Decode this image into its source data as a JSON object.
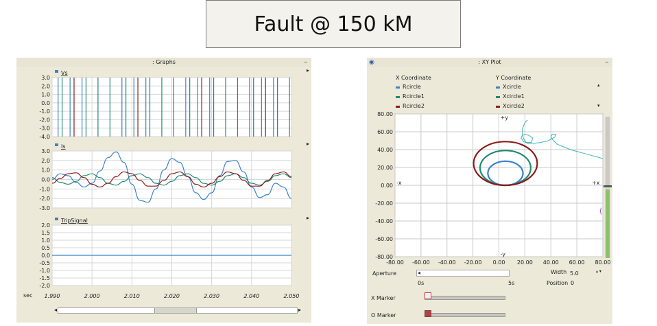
{
  "title": "Fault @ 150 kM",
  "graphs_panel": {
    "title": ": Graphs",
    "min_symbol": "–",
    "time_unit": "sec",
    "x_ticks": [
      "1.990",
      "2.000",
      "2.010",
      "2.020",
      "2.030",
      "2.040",
      "2.050"
    ],
    "x_range": [
      1.99,
      2.05
    ]
  },
  "xy_panel": {
    "title": ": XY Plot",
    "min_symbol": "–",
    "x_coord_header": "X Coordinate",
    "y_coord_header": "Y Coordinate",
    "x_legend": [
      {
        "name": "Rcircle",
        "color": "#3b82c9"
      },
      {
        "name": "Rcircle1",
        "color": "#1f8a70"
      },
      {
        "name": "Rcircle2",
        "color": "#8b1a1a"
      }
    ],
    "y_legend": [
      {
        "name": "Xcircle",
        "color": "#3b82c9"
      },
      {
        "name": "Xcircle1",
        "color": "#1f8a70"
      },
      {
        "name": "Xcircle2",
        "color": "#8b1a1a"
      }
    ],
    "axis_labels": {
      "plus_y": "+y",
      "minus_y": "-y",
      "plus_x": "+x",
      "minus_x": "-x"
    },
    "aperture_label": "Aperture",
    "width_label": "Width",
    "width_value": "5.0",
    "time_start": "0s",
    "time_end": "5s",
    "position_label": "Position",
    "position_value": "0",
    "x_marker_label": "X Marker",
    "o_marker_label": "O Marker"
  },
  "chart_data": [
    {
      "type": "line",
      "title": "Vs",
      "ylim": [
        -4.0,
        3.0
      ],
      "y_ticks": [
        "3.0",
        "2.0",
        "1.0",
        "0.0",
        "-1.0",
        "-2.0",
        "-3.0",
        "-4.0"
      ],
      "grid": true,
      "series": [
        {
          "name": "Vs",
          "color": "#3b82c9",
          "spikes_x": [
            1.9915,
            1.9945,
            1.9975,
            2.0075,
            2.0105,
            2.0135,
            2.0235,
            2.0265,
            2.0295,
            2.0395,
            2.0425,
            2.0455
          ]
        },
        {
          "name": "Vs",
          "color": "#1f8a70",
          "spikes_x": [
            1.9925,
            1.9985,
            2.0015,
            2.0045,
            2.0085,
            2.0145,
            2.0175,
            2.0205,
            2.0245,
            2.0305,
            2.0335,
            2.0365,
            2.0405,
            2.0465,
            2.0495
          ]
        },
        {
          "name": "Vs",
          "color": "#8b1a1a",
          "spikes_x": [
            1.9955,
            2.0115,
            2.0275,
            2.0435
          ]
        }
      ]
    },
    {
      "type": "line",
      "title": "Is",
      "ylim": [
        -3.0,
        3.0
      ],
      "y_ticks": [
        "3.0",
        "2.0",
        "1.0",
        "0.0",
        "-1.0",
        "-2.0",
        "-3.0"
      ],
      "grid": true,
      "x": [
        1.99,
        1.992,
        1.994,
        1.996,
        1.998,
        2.0,
        2.002,
        2.004,
        2.006,
        2.008,
        2.01,
        2.012,
        2.014,
        2.016,
        2.018,
        2.02,
        2.022,
        2.024,
        2.026,
        2.028,
        2.03,
        2.032,
        2.034,
        2.036,
        2.038,
        2.04,
        2.042,
        2.044,
        2.046,
        2.048,
        2.05
      ],
      "series": [
        {
          "name": "Is",
          "color": "#3b82c9",
          "values": [
            0.0,
            0.6,
            0.4,
            -0.3,
            -0.8,
            -0.4,
            0.9,
            2.3,
            2.9,
            1.8,
            -0.5,
            -2.2,
            -2.4,
            -1.0,
            1.0,
            2.2,
            1.8,
            0.3,
            -1.4,
            -2.1,
            -1.4,
            0.4,
            1.9,
            2.0,
            0.8,
            -0.8,
            -1.9,
            -1.6,
            -0.4,
            -0.8,
            -2.0
          ]
        },
        {
          "name": "Is",
          "color": "#1f8a70",
          "values": [
            0.2,
            -0.3,
            -0.5,
            -0.2,
            0.4,
            0.6,
            0.2,
            -0.4,
            -0.6,
            -0.2,
            0.4,
            0.6,
            0.2,
            -0.4,
            -0.6,
            -0.2,
            0.4,
            0.6,
            0.2,
            -0.4,
            -0.6,
            -0.2,
            0.4,
            0.6,
            0.2,
            -0.4,
            -0.6,
            -0.2,
            0.4,
            0.6,
            0.2
          ]
        },
        {
          "name": "Is",
          "color": "#8b1a1a",
          "values": [
            -0.4,
            0.1,
            0.6,
            0.7,
            0.2,
            -0.5,
            -0.8,
            -0.4,
            0.3,
            0.8,
            0.6,
            -0.1,
            -0.7,
            -0.7,
            -0.1,
            0.6,
            0.8,
            0.3,
            -0.5,
            -0.8,
            -0.4,
            0.3,
            0.8,
            0.6,
            -0.1,
            -0.7,
            -0.7,
            -0.1,
            0.6,
            0.8,
            0.3
          ]
        }
      ]
    },
    {
      "type": "line",
      "title": "TripSignal",
      "ylim": [
        -2.0,
        2.0
      ],
      "y_ticks": [
        "2.0",
        "1.5",
        "1.0",
        "0.5",
        "0.0",
        "-0.5",
        "-1.0",
        "-1.5",
        "-2.0"
      ],
      "grid": true,
      "x": [
        1.99,
        2.05
      ],
      "series": [
        {
          "name": "TripSignal",
          "color": "#3b82c9",
          "values": [
            0.0,
            0.0
          ]
        }
      ]
    },
    {
      "type": "scatter",
      "title": "",
      "xlim": [
        -80,
        80
      ],
      "ylim": [
        -80,
        80
      ],
      "x_ticks": [
        "-80.00",
        "-60.00",
        "-40.00",
        "-20.00",
        "0.00",
        "20.00",
        "40.00",
        "60.00",
        "80.00"
      ],
      "y_ticks": [
        "80.00",
        "60.00",
        "40.00",
        "20.00",
        "0.00",
        "-20.00",
        "-40.00",
        "-60.00",
        "-80.00"
      ],
      "grid": true,
      "circles": [
        {
          "name": "Rcircle/Xcircle",
          "color": "#3b82c9",
          "center": [
            5,
            13.5
          ],
          "radius": 13.5
        },
        {
          "name": "Rcircle1/Xcircle1",
          "color": "#1f8a70",
          "center": [
            5,
            19.5
          ],
          "radius": 19.5
        },
        {
          "name": "Rcircle2/Xcircle2",
          "color": "#8b1a1a",
          "center": [
            5,
            24.5
          ],
          "radius": 24.5
        }
      ],
      "trajectory": {
        "color": "#3fb2b8",
        "x": [
          80,
          75,
          70,
          65,
          60,
          55,
          50,
          45,
          42,
          40,
          41,
          44,
          43,
          38,
          32,
          27,
          22,
          19,
          17,
          18,
          20,
          23,
          26,
          25,
          21,
          19,
          18,
          18,
          19,
          20,
          21,
          22
        ],
        "y": [
          30,
          32,
          34,
          36,
          38,
          40,
          43,
          46,
          50,
          54,
          57,
          57,
          54,
          50,
          48,
          47,
          47,
          49,
          53,
          56,
          57,
          56,
          53,
          48,
          48,
          52,
          58,
          63,
          67,
          70,
          72,
          73
        ]
      }
    }
  ]
}
